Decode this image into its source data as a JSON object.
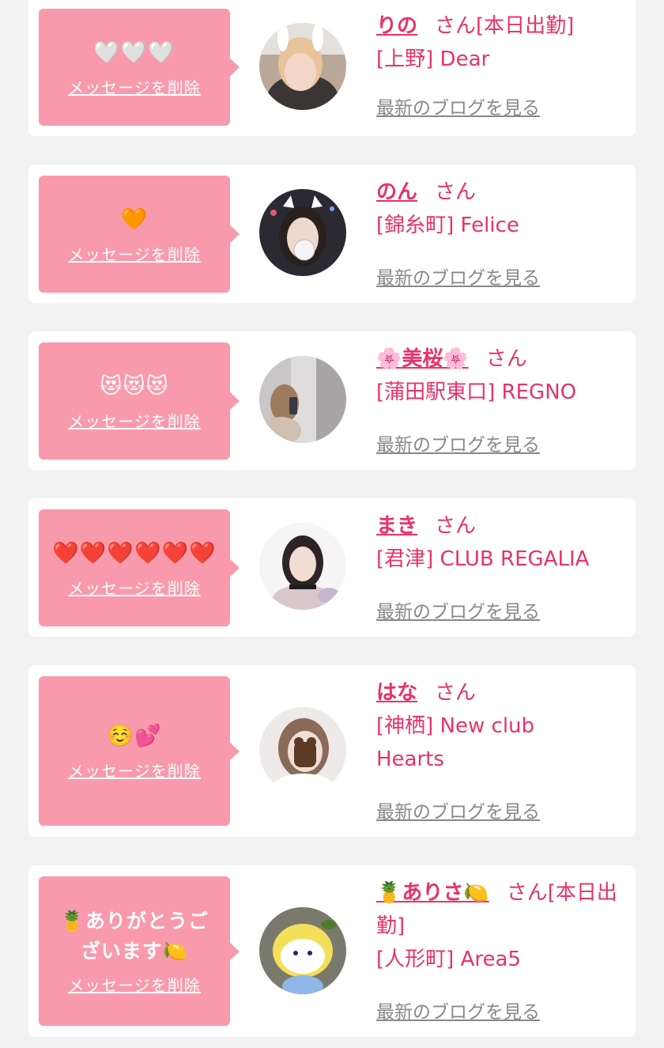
{
  "common": {
    "delete_label": "メッセージを削除",
    "blog_label": "最新のブログを見る"
  },
  "items": [
    {
      "message": "🤍🤍🤍",
      "name": "りの",
      "san": "さん[本日出勤]",
      "shop": "[上野] Dear"
    },
    {
      "message": "🧡",
      "name": "のん",
      "san": "さん",
      "shop": "[錦糸町] Felice"
    },
    {
      "message": "😻😻😻",
      "name": "🌸美桜🌸",
      "san": "さん",
      "shop": "[蒲田駅東口] REGNO"
    },
    {
      "message": "❤️❤️❤️❤️❤️❤️",
      "name": "まき",
      "san": "さん",
      "shop": "[君津] CLUB REGALIA"
    },
    {
      "message": "☺️💕",
      "name": "はな",
      "san": "さん",
      "shop": "[神栖] New club Hearts"
    },
    {
      "message": "🍍ありがとうございます🍋",
      "name": "🍍ありさ🍋",
      "san": "さん[本日出勤]",
      "shop": "[人形町] Area5"
    }
  ]
}
